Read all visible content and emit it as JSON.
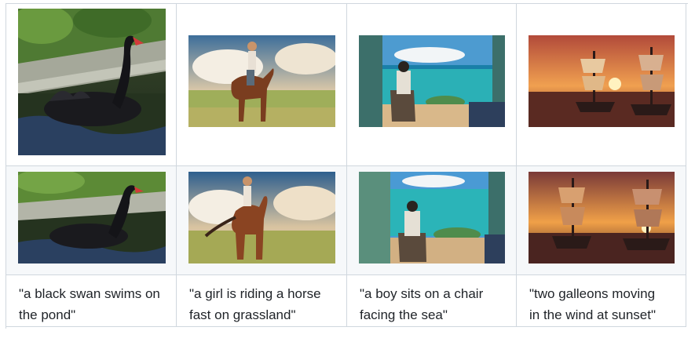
{
  "table": {
    "rows": [
      {
        "cells": [
          {
            "image": "black-swan-on-pond-square",
            "name": "swan-image-original"
          },
          {
            "image": "girl-riding-horse-on-grassland",
            "name": "horse-image-original"
          },
          {
            "image": "boy-on-chair-facing-sea",
            "name": "sea-image-original"
          },
          {
            "image": "galleons-at-sunset",
            "name": "galleon-image-original"
          }
        ]
      },
      {
        "cells": [
          {
            "image": "black-swan-on-pond-wide",
            "name": "swan-image-edited"
          },
          {
            "image": "girl-riding-horse-fast",
            "name": "horse-image-edited"
          },
          {
            "image": "boy-on-chair-facing-sea",
            "name": "sea-image-edited"
          },
          {
            "image": "galleons-in-wind-at-sunset",
            "name": "galleon-image-edited"
          }
        ]
      }
    ],
    "captions": [
      {
        "line1": "\"a black swan swims on",
        "line2": "the pond\""
      },
      {
        "line1": "\"a girl is riding a horse",
        "line2": "fast on grassland\""
      },
      {
        "line1": "\"a boy sits on a chair",
        "line2": "facing the sea\""
      },
      {
        "line1": "\"two galleons moving",
        "line2": "in the wind at sunset\""
      }
    ]
  },
  "colors": {
    "border": "#d0d7de",
    "row_alt_background": "#f6f8fa",
    "text": "#1f2328"
  }
}
